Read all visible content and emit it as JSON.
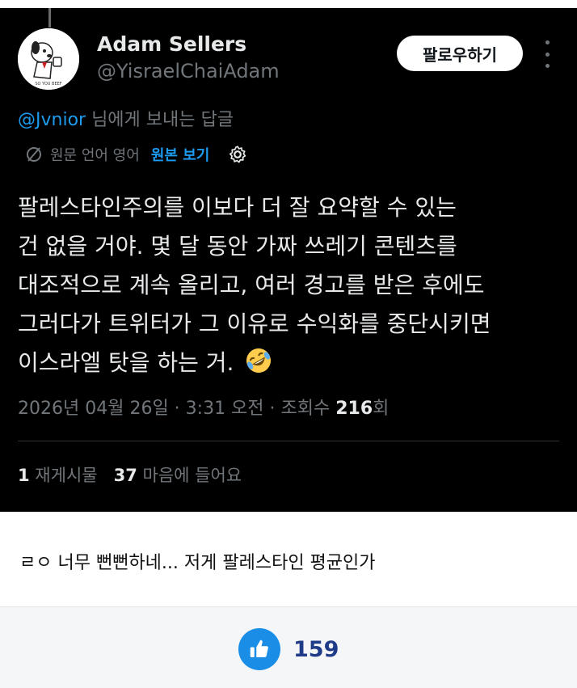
{
  "tweet": {
    "author_name": "Adam Sellers",
    "handle": "@YisraelChaiAdam",
    "follow_label": "팔로우하기",
    "reply_mention": "@Jvnior",
    "reply_suffix": " 님에게 보내는 답글",
    "translate_info": "원문 언어 영어",
    "translate_show": "원본 보기",
    "body_lines": [
      "팔레스타인주의를 이보다 더 잘 요약할 수 있는",
      "건 없을 거야. 몇 달 동안 가짜 쓰레기 콘텐츠를",
      "대조적으로 계속 올리고, 여러 경고를 받은 후에도",
      "그러다가 트위터가 그 이유로 수익화를 중단시키면",
      "이스라엘 탓을 하는 거."
    ],
    "timestamp": "2026년 04월 26일 · 3:31 오전 · 조회수 ",
    "views": "216",
    "views_suffix": "회",
    "reposts": "1",
    "reposts_label": " 재게시물",
    "likes": "37",
    "likes_label": " 마음에 들어요"
  },
  "post": {
    "caption": "ㄹㅇ 너무 뻔뻔하네... 저게 팔레스타인 평균인가",
    "like_count": "159"
  },
  "icons": {
    "emoji": "rolling-on-floor-laughing",
    "translate": "globe-icon",
    "settings": "gear-icon",
    "like": "thumbs-up-icon"
  },
  "colors": {
    "accent": "#1d9bf0",
    "like_button": "#1a8ee6",
    "like_count": "#1f3c88"
  }
}
